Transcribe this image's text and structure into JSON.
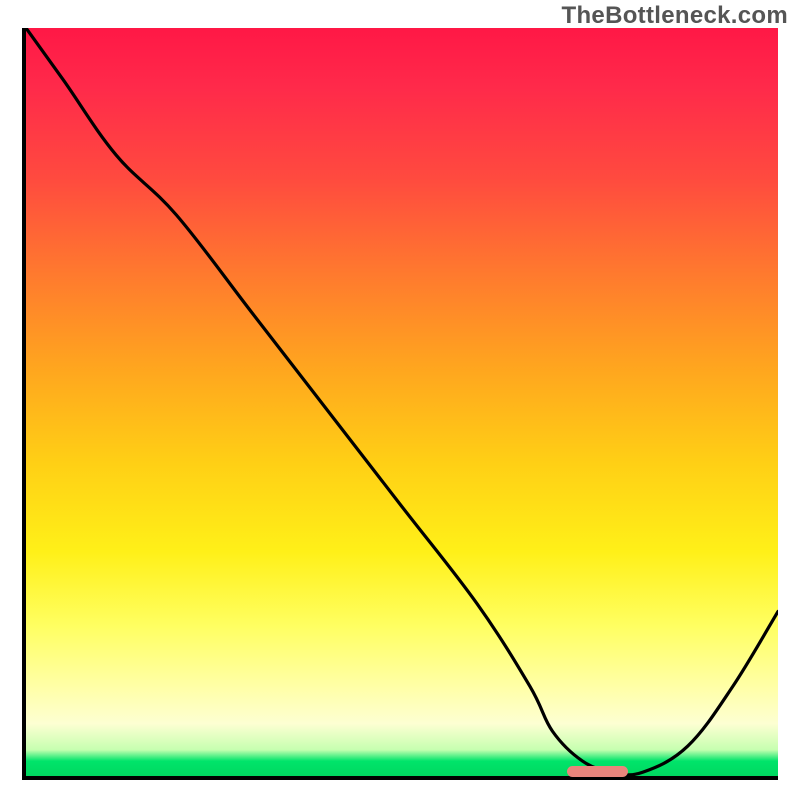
{
  "watermark": "TheBottleneck.com",
  "chart_data": {
    "type": "line",
    "title": "",
    "xlabel": "",
    "ylabel": "",
    "xlim": [
      0,
      100
    ],
    "ylim": [
      0,
      100
    ],
    "grid": false,
    "legend": false,
    "note": "Axes unlabelled in source image; x and y expressed as 0–100 percent of plot area (x left→right, y bottom→top). Values read from curve geometry.",
    "series": [
      {
        "name": "bottleneck-curve",
        "color": "#000000",
        "x": [
          0,
          5,
          12,
          20,
          30,
          40,
          50,
          60,
          67,
          70,
          74,
          78,
          82,
          88,
          94,
          100
        ],
        "y": [
          100,
          93,
          83,
          75,
          62,
          49,
          36,
          23,
          12,
          6,
          2,
          0.5,
          0.5,
          4,
          12,
          22
        ]
      }
    ],
    "marker": {
      "name": "optimal-range",
      "color": "#e9857c",
      "x_start": 72,
      "x_end": 80,
      "y": 0.7
    }
  }
}
